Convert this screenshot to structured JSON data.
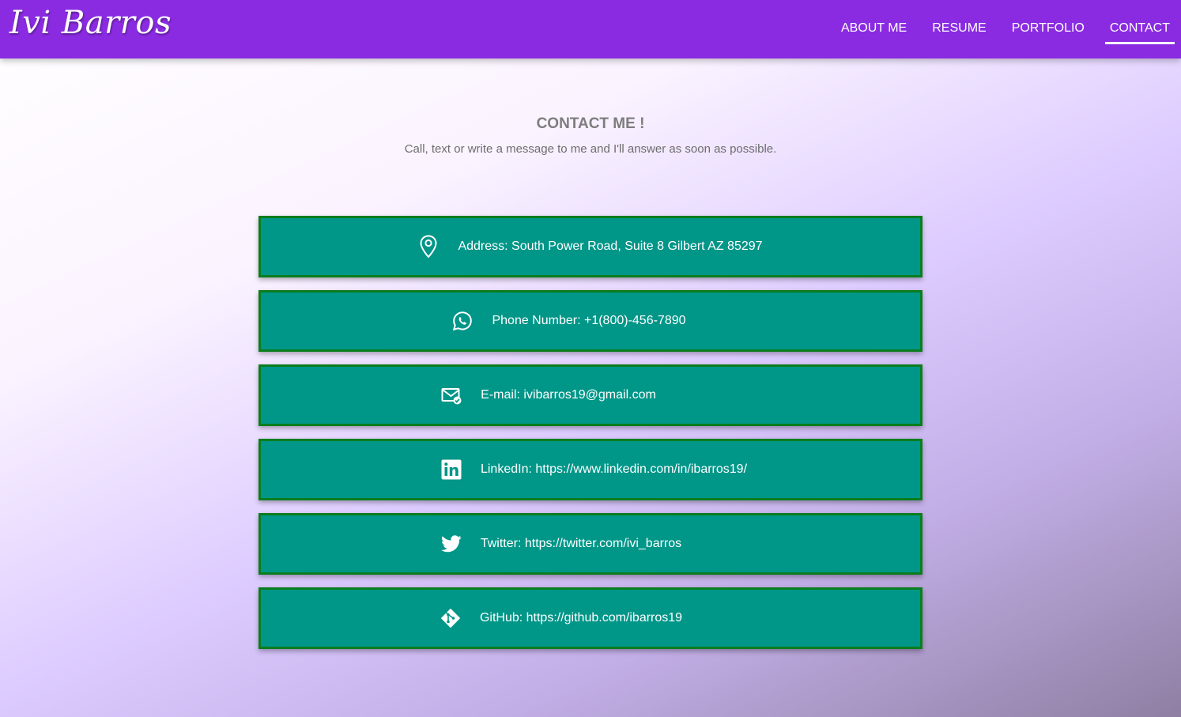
{
  "brand": {
    "name": "Ivi Barros"
  },
  "nav": {
    "items": [
      {
        "label": "ABOUT ME"
      },
      {
        "label": "RESUME"
      },
      {
        "label": "PORTFOLIO"
      },
      {
        "label": "CONTACT"
      }
    ],
    "active": "CONTACT"
  },
  "contact": {
    "title": "CONTACT ME !",
    "subtitle": "Call, text or write a message to me and I'll answer as soon as possible.",
    "items": [
      {
        "icon": "map-pin-icon",
        "text": "Address: South Power Road, Suite 8 Gilbert AZ 85297"
      },
      {
        "icon": "whatsapp-icon",
        "text": "Phone Number: +1(800)-456-7890"
      },
      {
        "icon": "mail-check-icon",
        "text": "E-mail: ivibarros19@gmail.com"
      },
      {
        "icon": "linkedin-icon",
        "text": "LinkedIn: https://www.linkedin.com/in/ibarros19/"
      },
      {
        "icon": "twitter-icon",
        "text": "Twitter: https://twitter.com/ivi_barros"
      },
      {
        "icon": "git-icon",
        "text": "GitHub: https://github.com/ibarros19"
      }
    ]
  },
  "colors": {
    "navbar": "#8a2be2",
    "card": "#009688",
    "card_border": "#0a7d1e"
  }
}
